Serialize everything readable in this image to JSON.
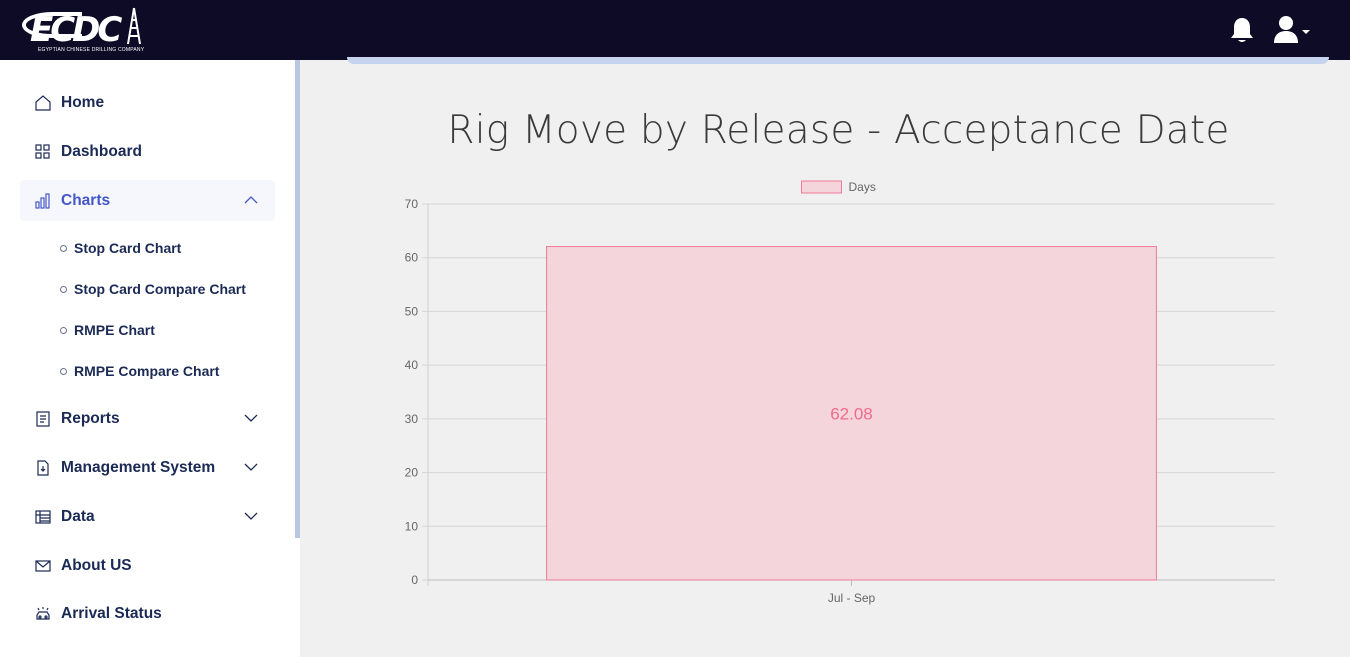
{
  "header": {
    "logo_text": "ECDC",
    "logo_subtitle": "EGYPTIAN CHINESE DRILLING COMPANY"
  },
  "sidebar": {
    "items": [
      {
        "label": "Home",
        "icon": "home-icon"
      },
      {
        "label": "Dashboard",
        "icon": "grid-icon"
      },
      {
        "label": "Charts",
        "icon": "bar-chart-icon",
        "active": true,
        "expanded": true
      },
      {
        "label": "Reports",
        "icon": "report-icon"
      },
      {
        "label": "Management System",
        "icon": "document-download-icon"
      },
      {
        "label": "Data",
        "icon": "table-icon"
      },
      {
        "label": "About US",
        "icon": "envelope-icon"
      },
      {
        "label": "Arrival Status",
        "icon": "car-alert-icon"
      }
    ],
    "chart_subitems": [
      "Stop Card Chart",
      "Stop Card Compare Chart",
      "RMPE Chart",
      "RMPE Compare Chart"
    ]
  },
  "main": {
    "title": "Rig Move by Release - Acceptance Date"
  },
  "chart_data": {
    "type": "bar",
    "categories": [
      "Jul - Sep"
    ],
    "series": [
      {
        "name": "Days",
        "values": [
          62.08
        ]
      }
    ],
    "data_labels": [
      "62.08"
    ],
    "ylim": [
      0,
      70
    ],
    "yticks": [
      0,
      10,
      20,
      30,
      40,
      50,
      60,
      70
    ],
    "grid": true,
    "legend": "top-center",
    "colors": {
      "bar_fill": "#f4d5dc",
      "bar_stroke": "#f07a98",
      "label": "#f06a8a"
    }
  }
}
